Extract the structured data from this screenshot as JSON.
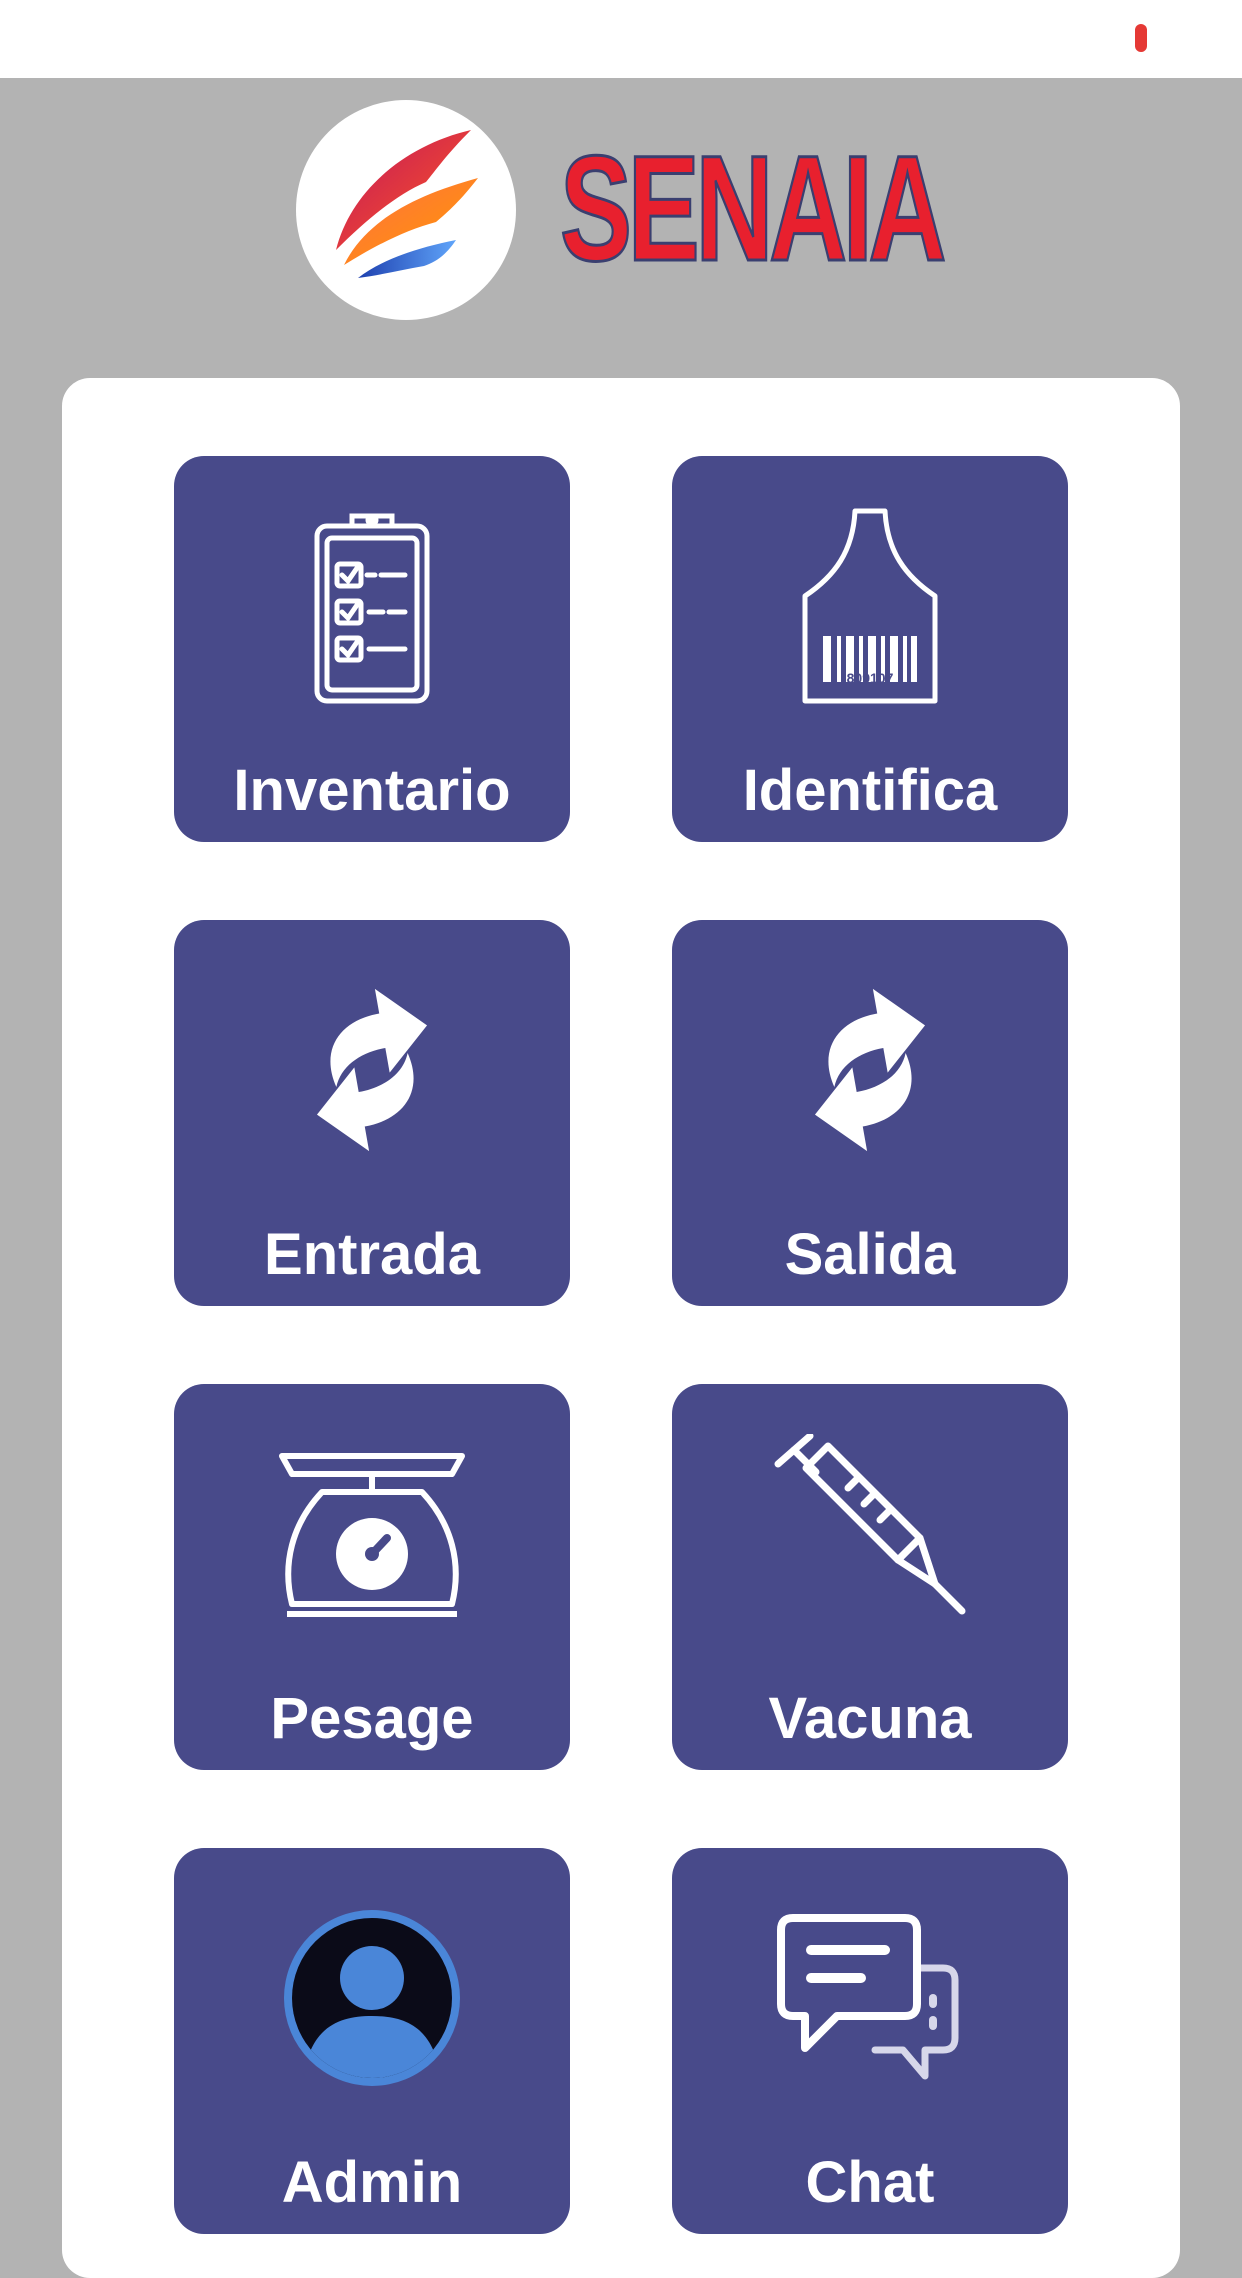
{
  "colors": {
    "tile_bg": "#484a8a",
    "brand_red": "#e8202e",
    "status_indicator": "#e53935",
    "background": "#b3b3b3",
    "card": "#ffffff"
  },
  "brand": {
    "name": "SENAIA",
    "logo_icon": "feather-logo-icon"
  },
  "menu": {
    "tiles": [
      {
        "label": "Inventario",
        "icon": "clipboard-checklist-icon"
      },
      {
        "label": "Identifica",
        "icon": "ear-tag-barcode-icon",
        "tag_number": "809107"
      },
      {
        "label": "Entrada",
        "icon": "sync-arrows-icon"
      },
      {
        "label": "Salida",
        "icon": "sync-arrows-icon"
      },
      {
        "label": "Pesage",
        "icon": "weighing-scale-icon"
      },
      {
        "label": "Vacuna",
        "icon": "syringe-icon"
      },
      {
        "label": "Admin",
        "icon": "user-avatar-icon"
      },
      {
        "label": "Chat",
        "icon": "chat-bubbles-icon"
      }
    ]
  }
}
